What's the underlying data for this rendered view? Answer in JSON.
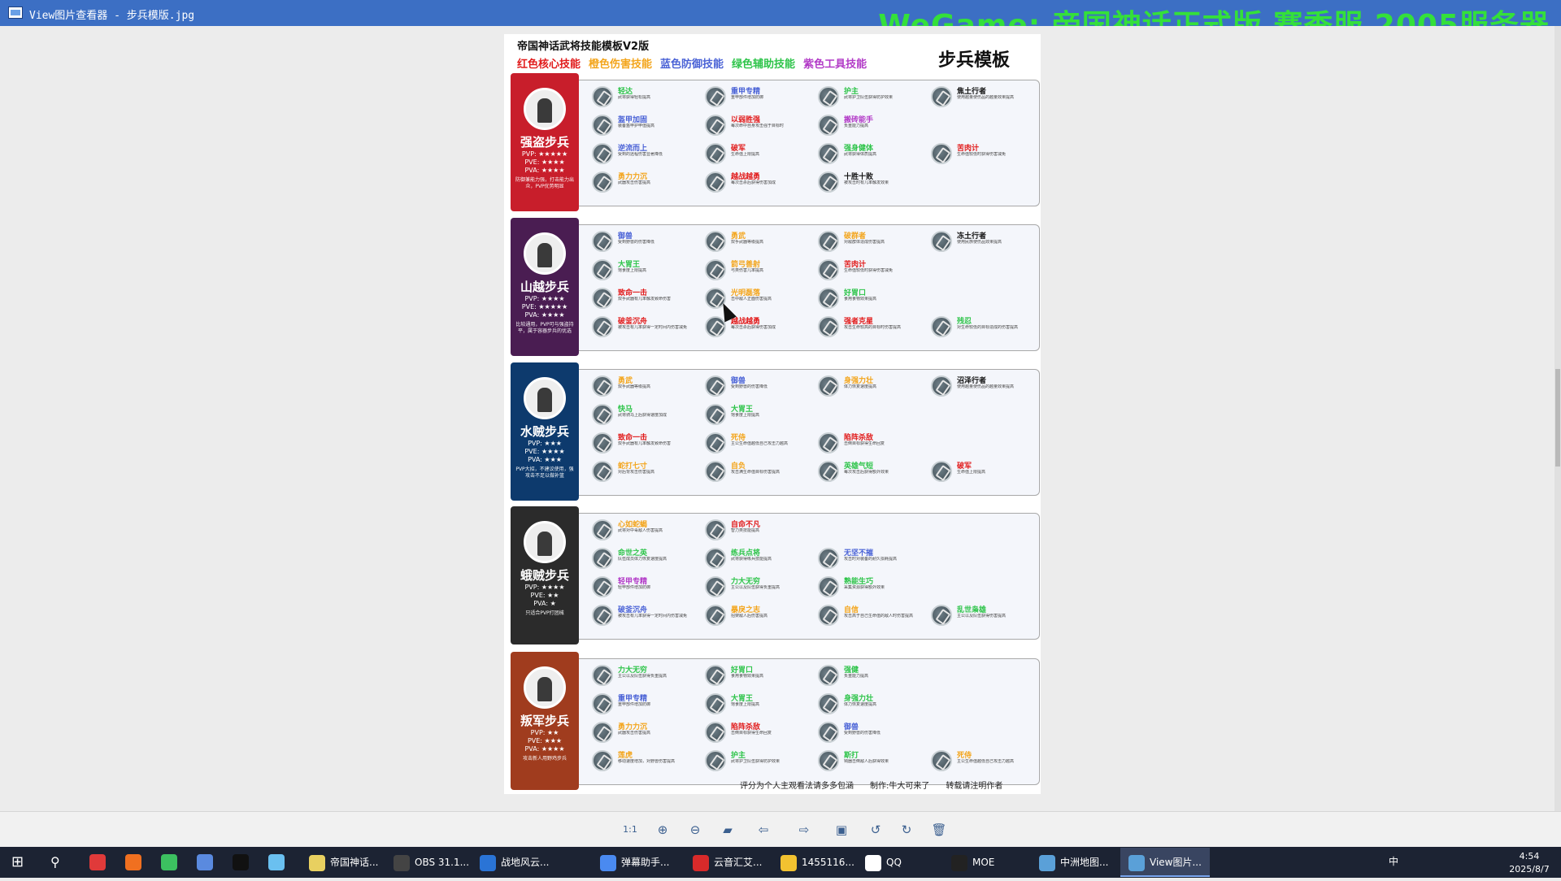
{
  "window": {
    "title": "View图片查看器 - 步兵模版.jpg",
    "overlay_banner": "WeGame: 帝国神话正式版 赛季服 2005服务器"
  },
  "poster": {
    "title": "帝国神话武将技能模板V2版",
    "type_title": "步兵模板",
    "legend": [
      {
        "label": "红色核心技能",
        "color": "#e11b1b"
      },
      {
        "label": "橙色伤害技能",
        "color": "#f3a51c"
      },
      {
        "label": "蓝色防御技能",
        "color": "#4a62d6"
      },
      {
        "label": "绿色辅助技能",
        "color": "#2ec44a"
      },
      {
        "label": "紫色工具技能",
        "color": "#b23ac7"
      }
    ],
    "footer": "评分为个人主观看法请多多包涵　　制作:牛大可来了　　转载请注明作者",
    "units": [
      {
        "name": "强盗步兵",
        "pvp": "PVP: ★★★★★",
        "pve": "PVE: ★★★★",
        "pva": "PVA: ★★★★",
        "desc": "防御兼能力强，打击能力出众，PVP优势明显",
        "color": "#c81e2b",
        "skills": [
          {
            "name": "轻达",
            "color": "#2ec44a",
            "desc": "武将获得轻松提高"
          },
          {
            "name": "重甲专精",
            "color": "#4a62d6",
            "desc": "重甲部件增加防御"
          },
          {
            "name": "护主",
            "color": "#2ec44a",
            "desc": "武将护卫队伍获得防护效果"
          },
          {
            "name": "焦土行者",
            "color": "#111111",
            "desc": "使用越量使伤品的越量效果提高"
          },
          {
            "name": "盔甲加固",
            "color": "#4a62d6",
            "desc": "装备盔甲护甲值提高"
          },
          {
            "name": "以弱胜强",
            "color": "#e11b1b",
            "desc": "每次命中自身攻击强于目标时"
          },
          {
            "name": "搬砖能手",
            "color": "#b23ac7",
            "desc": "负重能力提高"
          },
          {
            "name": "",
            "color": "#111111",
            "desc": ""
          },
          {
            "name": "逆流而上",
            "color": "#4a62d6",
            "desc": "受到的远程伤害显著降低"
          },
          {
            "name": "破军",
            "color": "#e11b1b",
            "desc": "生命值上限提高"
          },
          {
            "name": "强身健体",
            "color": "#2ec44a",
            "desc": "武将获得体质提高"
          },
          {
            "name": "苦肉计",
            "color": "#e11b1b",
            "desc": "生命值较低时获得伤害减免"
          },
          {
            "name": "勇力力沉",
            "color": "#f3a51c",
            "desc": "武器攻击伤害提高"
          },
          {
            "name": "越战越勇",
            "color": "#e11b1b",
            "desc": "每次击杀后获得伤害加成"
          },
          {
            "name": "十胜十败",
            "color": "#111111",
            "desc": "被攻击时有几率触发效果"
          },
          {
            "name": "",
            "color": "#111111",
            "desc": ""
          }
        ]
      },
      {
        "name": "山越步兵",
        "pvp": "PVP: ★★★★",
        "pve": "PVE: ★★★★★",
        "pva": "PVA: ★★★★",
        "desc": "比较通用，PVP可与强盗持平，属于容器步兵的优选",
        "color": "#4a1d52",
        "skills": [
          {
            "name": "御兽",
            "color": "#4a62d6",
            "desc": "受到野兽的伤害降低"
          },
          {
            "name": "勇武",
            "color": "#f3a51c",
            "desc": "双手武器等级提高"
          },
          {
            "name": "破群者",
            "color": "#f3a51c",
            "desc": "对敌群体造成伤害提高"
          },
          {
            "name": "冻土行者",
            "color": "#111111",
            "desc": "使用民族使伤品效果提高"
          },
          {
            "name": "大胃王",
            "color": "#2ec44a",
            "desc": "饱食度上限提高"
          },
          {
            "name": "箭弓善射",
            "color": "#f3a51c",
            "desc": "弓类伤害几率提高"
          },
          {
            "name": "苦肉计",
            "color": "#e11b1b",
            "desc": "生命值较低时获得伤害减免"
          },
          {
            "name": "",
            "color": "#111111",
            "desc": ""
          },
          {
            "name": "致命一击",
            "color": "#e11b1b",
            "desc": "双手武器有几率触发致命伤害"
          },
          {
            "name": "光明磊落",
            "color": "#f3a51c",
            "desc": "击中敌人正面伤害提高"
          },
          {
            "name": "好胃口",
            "color": "#2ec44a",
            "desc": "食用食物效果提高"
          },
          {
            "name": "",
            "color": "#111111",
            "desc": ""
          },
          {
            "name": "破釜沉舟",
            "color": "#e11b1b",
            "desc": "被攻击有几率获得一定时间内伤害减免"
          },
          {
            "name": "越战越勇",
            "color": "#e11b1b",
            "desc": "每次击杀后获得伤害加成"
          },
          {
            "name": "强者克星",
            "color": "#e11b1b",
            "desc": "攻击生命较高的目标时伤害提高"
          },
          {
            "name": "残忍",
            "color": "#2ec44a",
            "desc": "对生命较低的目标造成的伤害提高"
          }
        ]
      },
      {
        "name": "水贼步兵",
        "pvp": "PVP: ★★★",
        "pve": "PVE: ★★★★",
        "pva": "PVA: ★★★",
        "desc": "PVP大招，不建议使用，强攻击不足以做补篮",
        "color": "#0d3a6d",
        "skills": [
          {
            "name": "勇武",
            "color": "#f3a51c",
            "desc": "双手武器等级提高"
          },
          {
            "name": "御兽",
            "color": "#4a62d6",
            "desc": "受到野兽的伤害降低"
          },
          {
            "name": "身强力壮",
            "color": "#f3a51c",
            "desc": "体力恢复速度提高"
          },
          {
            "name": "沼泽行者",
            "color": "#111111",
            "desc": "使用越量使伤品的越量效果提高"
          },
          {
            "name": "快马",
            "color": "#2ec44a",
            "desc": "武将骑马上后获得速度加成"
          },
          {
            "name": "大胃王",
            "color": "#2ec44a",
            "desc": "饱食度上限提高"
          },
          {
            "name": "",
            "color": "#111111",
            "desc": ""
          },
          {
            "name": "",
            "color": "#111111",
            "desc": ""
          },
          {
            "name": "致命一击",
            "color": "#e11b1b",
            "desc": "双手武器有几率触发致命伤害"
          },
          {
            "name": "死侍",
            "color": "#f3a51c",
            "desc": "主公生命值越低自己攻击力越高"
          },
          {
            "name": "陷阵杀敌",
            "color": "#e11b1b",
            "desc": "击倒目标获得生命回复"
          },
          {
            "name": "",
            "color": "#111111",
            "desc": ""
          },
          {
            "name": "蛇打七寸",
            "color": "#f3a51c",
            "desc": "对后背攻击伤害提高"
          },
          {
            "name": "自负",
            "color": "#f3a51c",
            "desc": "攻击满生命值目标伤害提高"
          },
          {
            "name": "英雄气短",
            "color": "#2ec44a",
            "desc": "每次攻击后获得额外效果"
          },
          {
            "name": "破军",
            "color": "#e11b1b",
            "desc": "生命值上限提高"
          }
        ]
      },
      {
        "name": "蛾贼步兵",
        "pvp": "PVP: ★★★★",
        "pve": "PVE: ★★",
        "pva": "PVA: ★",
        "desc": "只适合PVP打团械",
        "color": "#2b2b2b",
        "skills": [
          {
            "name": "心如蛇蝎",
            "color": "#f3a51c",
            "desc": "武将对中毒敌人伤害提高"
          },
          {
            "name": "自命不凡",
            "color": "#e11b1b",
            "desc": "智力类技能提高"
          },
          {
            "name": "",
            "color": "#111111",
            "desc": ""
          },
          {
            "name": "",
            "color": "#111111",
            "desc": ""
          },
          {
            "name": "命世之英",
            "color": "#2ec44a",
            "desc": "队伍成员体力恢复速度提高"
          },
          {
            "name": "练兵点将",
            "color": "#2ec44a",
            "desc": "武将获得练兵技能提高"
          },
          {
            "name": "无坚不摧",
            "color": "#4a62d6",
            "desc": "攻击时对装备的耐久损耗提高"
          },
          {
            "name": "",
            "color": "#111111",
            "desc": ""
          },
          {
            "name": "轻甲专精",
            "color": "#b23ac7",
            "desc": "轻甲部件增加防御"
          },
          {
            "name": "力大无穷",
            "color": "#2ec44a",
            "desc": "主公以及队伍获得负重提高"
          },
          {
            "name": "熟能生巧",
            "color": "#2ec44a",
            "desc": "采集资源获得额外效果"
          },
          {
            "name": "",
            "color": "#111111",
            "desc": ""
          },
          {
            "name": "破釜沉舟",
            "color": "#4a62d6",
            "desc": "被攻击有几率获得一定时间内伤害减免"
          },
          {
            "name": "暴戾之志",
            "color": "#f3a51c",
            "desc": "招架敌人后伤害提高"
          },
          {
            "name": "自信",
            "color": "#f3a51c",
            "desc": "攻击高于自己生命值的敌人时伤害提高"
          },
          {
            "name": "乱世枭雄",
            "color": "#2ec44a",
            "desc": "主公以及队伍获得伤害提高"
          }
        ]
      },
      {
        "name": "叛军步兵",
        "pvp": "PVP: ★★",
        "pve": "PVE: ★★★",
        "pva": "PVA: ★★★★",
        "desc": "攻击新人用野鸡步兵",
        "color": "#a03c1e",
        "skills": [
          {
            "name": "力大无穷",
            "color": "#2ec44a",
            "desc": "主公以及队伍获得负重提高"
          },
          {
            "name": "好胃口",
            "color": "#2ec44a",
            "desc": "食用食物效果提高"
          },
          {
            "name": "强健",
            "color": "#2ec44a",
            "desc": "负重能力提高"
          },
          {
            "name": "",
            "color": "#111111",
            "desc": ""
          },
          {
            "name": "重甲专精",
            "color": "#4a62d6",
            "desc": "重甲部件增加防御"
          },
          {
            "name": "大胃王",
            "color": "#2ec44a",
            "desc": "饱食度上限提高"
          },
          {
            "name": "身强力壮",
            "color": "#2ec44a",
            "desc": "体力恢复速度提高"
          },
          {
            "name": "",
            "color": "#111111",
            "desc": ""
          },
          {
            "name": "勇力力沉",
            "color": "#f3a51c",
            "desc": "武器攻击伤害提高"
          },
          {
            "name": "陷阵杀敌",
            "color": "#e11b1b",
            "desc": "击倒目标获得生命回复"
          },
          {
            "name": "御兽",
            "color": "#4a62d6",
            "desc": "受到野兽的伤害降低"
          },
          {
            "name": "",
            "color": "#111111",
            "desc": ""
          },
          {
            "name": "莲虎",
            "color": "#f3a51c",
            "desc": "移动速度增加，对野兽伤害提高"
          },
          {
            "name": "护主",
            "color": "#2ec44a",
            "desc": "武将护卫队伍获得防护效果"
          },
          {
            "name": "斯打",
            "color": "#2ec44a",
            "desc": "钝器击倒敌人后获得效果"
          },
          {
            "name": "死侍",
            "color": "#f3a51c",
            "desc": "主公生命值越低自己攻击力越高"
          }
        ]
      }
    ]
  },
  "toolbar": [
    {
      "name": "actual-size-button",
      "glyph": "1:1"
    },
    {
      "name": "zoom-in-button",
      "glyph": "⊕"
    },
    {
      "name": "zoom-out-button",
      "glyph": "⊖"
    },
    {
      "name": "open-folder-button",
      "glyph": "▰"
    },
    {
      "name": "previous-button",
      "glyph": "⇦"
    },
    {
      "name": "next-button",
      "glyph": "⇨"
    },
    {
      "name": "save-button",
      "glyph": "▣"
    },
    {
      "name": "rotate-left-button",
      "glyph": "↺"
    },
    {
      "name": "rotate-right-button",
      "glyph": "↻"
    },
    {
      "name": "delete-button",
      "glyph": "🗑"
    }
  ],
  "taskbar": {
    "apps": [
      "帝国神话...",
      "OBS 31.1...",
      "战地风云...",
      "弹幕助手...",
      "云音汇艾...",
      "1455116...",
      "QQ",
      "MOE",
      "中洲地图...",
      "View图片..."
    ],
    "ime": "中",
    "time": "4:54",
    "date": "2025/8/7"
  }
}
